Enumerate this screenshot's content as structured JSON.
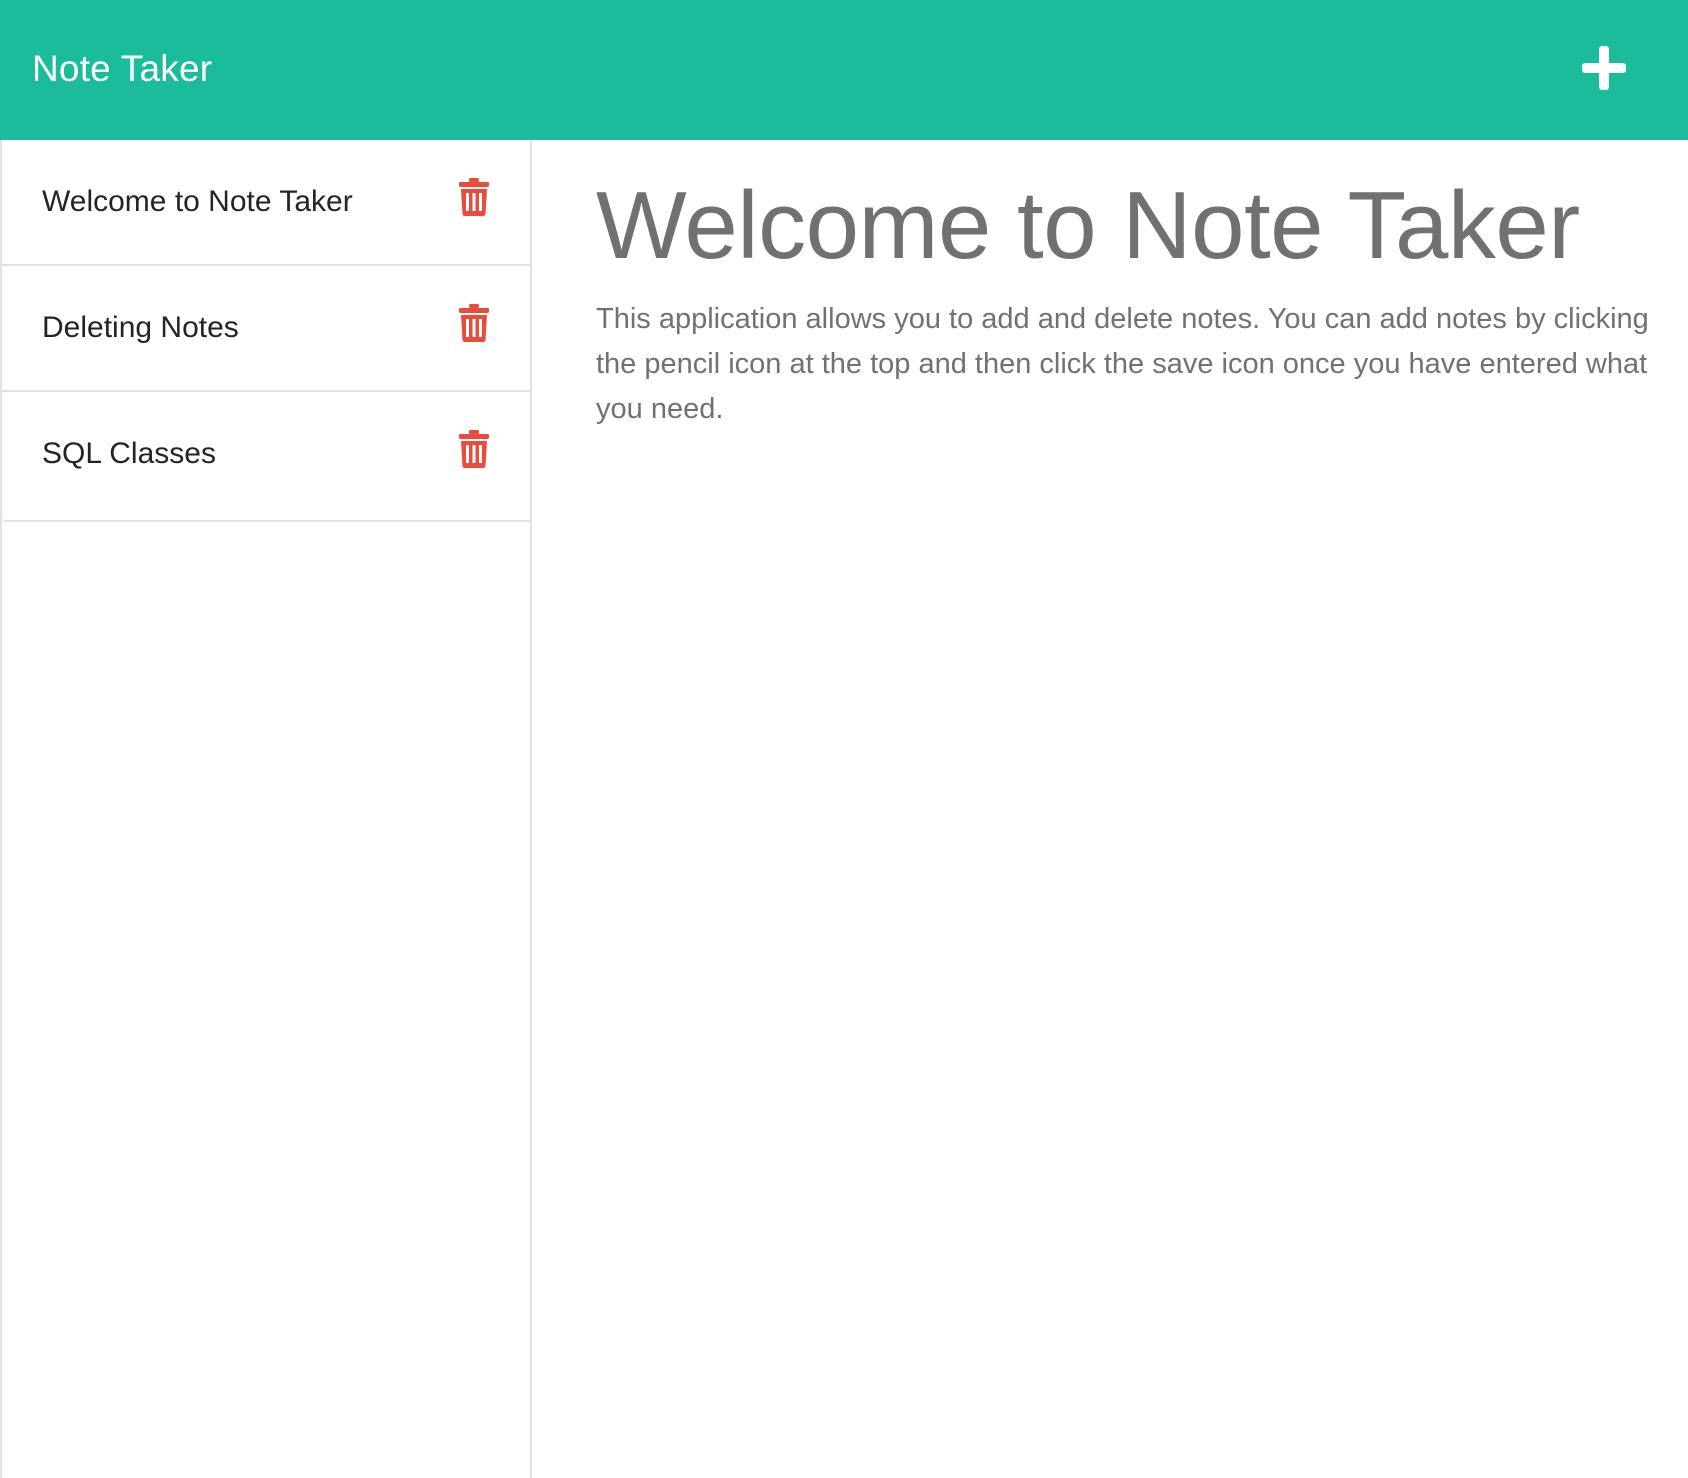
{
  "header": {
    "title": "Note Taker",
    "new_note_icon": "plus-icon",
    "accent_color": "#1abc9c"
  },
  "sidebar": {
    "delete_icon": "trash-icon",
    "delete_color": "#e74c3c",
    "notes": [
      {
        "title": "Welcome to Note Taker"
      },
      {
        "title": "Deleting Notes"
      },
      {
        "title": "SQL Classes"
      }
    ]
  },
  "main": {
    "note_title": "Welcome to Note Taker",
    "note_text": "This application allows you to add and delete notes. You can add notes by clicking the pencil icon at the top and then click the save icon once you have entered what you need."
  }
}
